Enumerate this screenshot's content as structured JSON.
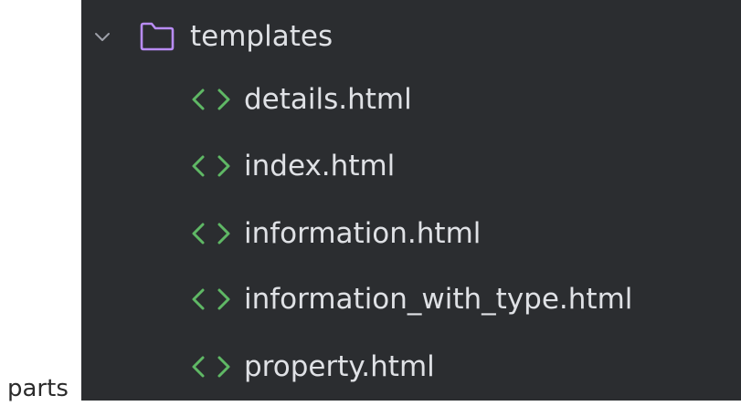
{
  "outside_label": "parts",
  "tree": {
    "folder": {
      "name": "templates",
      "expanded": true,
      "chevron_icon": "chevron-down-icon",
      "icon": "folder-icon"
    },
    "files": [
      {
        "name": "details.html",
        "icon": "html-file-icon"
      },
      {
        "name": "index.html",
        "icon": "html-file-icon"
      },
      {
        "name": "information.html",
        "icon": "html-file-icon"
      },
      {
        "name": "information_with_type.html",
        "icon": "html-file-icon"
      },
      {
        "name": "property.html",
        "icon": "html-file-icon"
      }
    ]
  },
  "colors": {
    "panel_background": "#2b2d30",
    "text": "#dfe1e5",
    "folder_icon": "#b98cf5",
    "html_icon": "#5fb865",
    "chevron": "#9da0a8"
  }
}
